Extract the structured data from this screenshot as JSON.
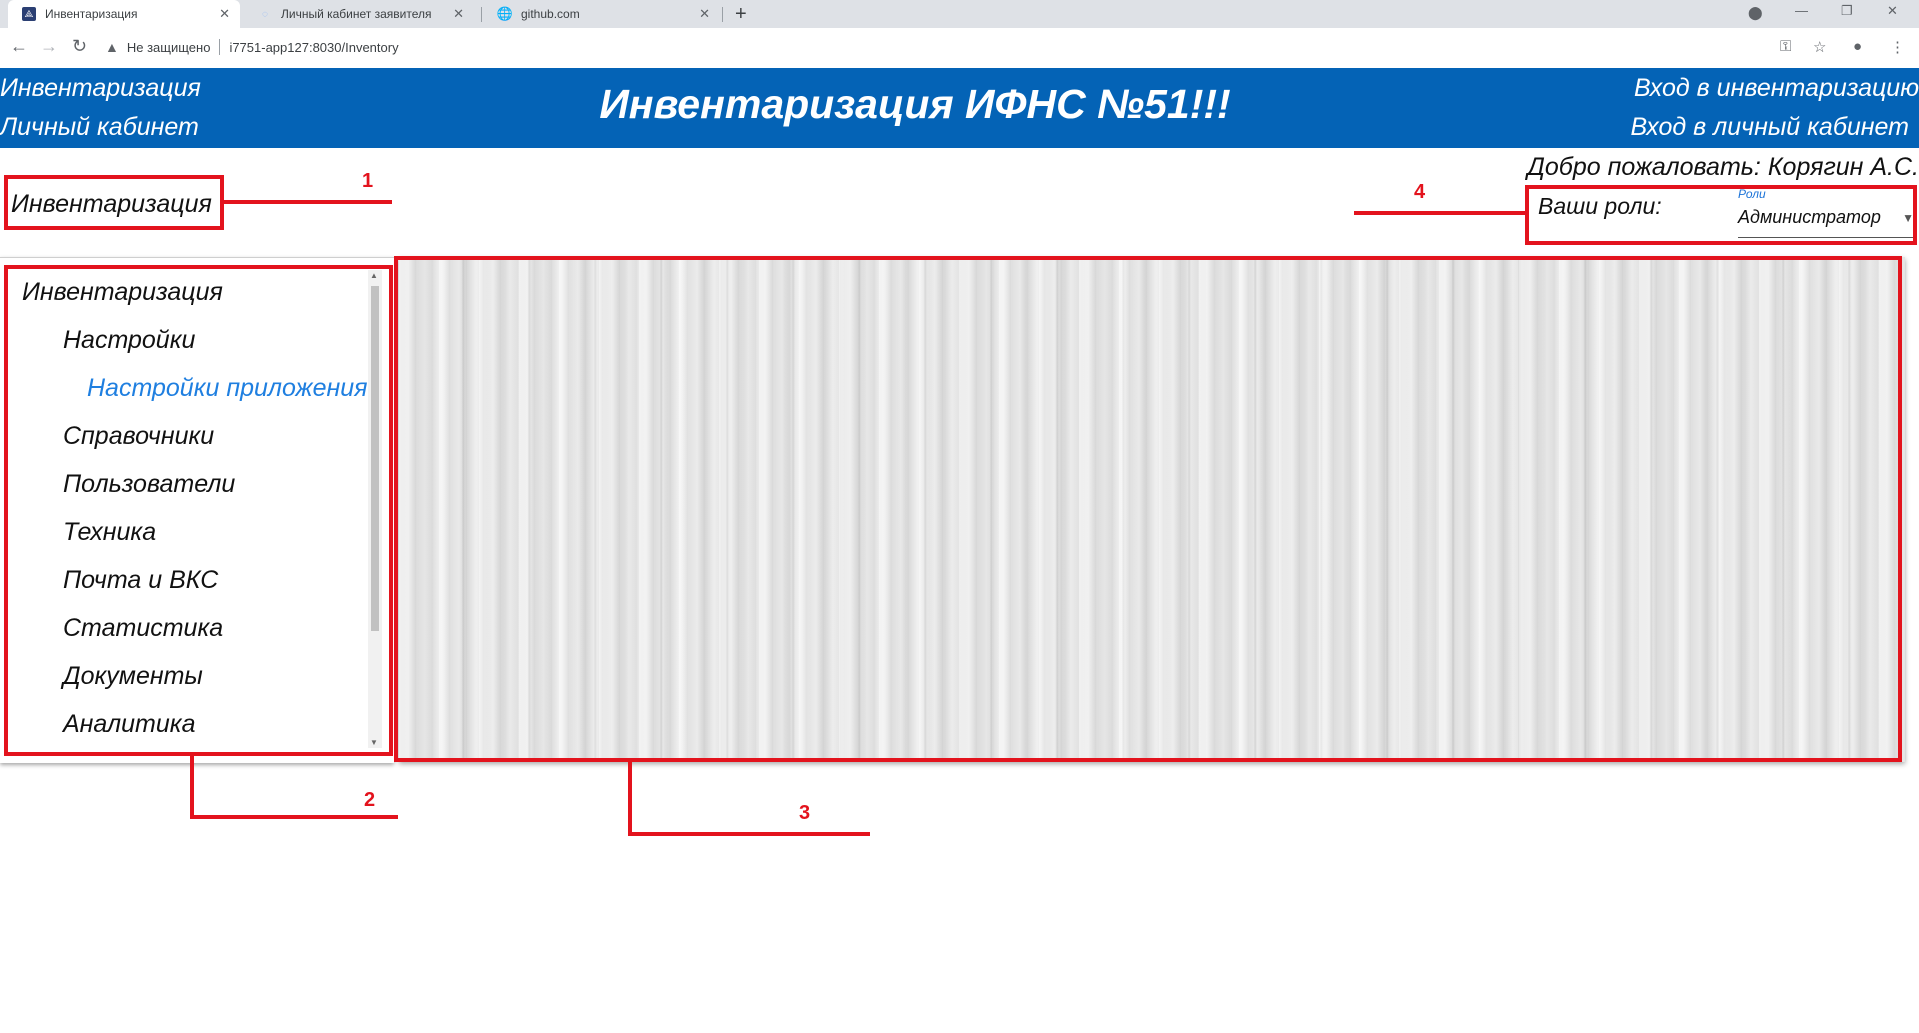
{
  "browser": {
    "tabs": [
      {
        "title": "Инвентаризация",
        "active": true,
        "icon": "app-icon"
      },
      {
        "title": "Личный кабинет заявителя",
        "active": false,
        "icon": "loading-icon"
      },
      {
        "title": "github.com",
        "active": false,
        "icon": "globe-icon"
      }
    ],
    "security_label": "Не защищено",
    "url": "i7751-app127:8030/Inventory"
  },
  "header": {
    "left_links": [
      "Инвентаризация",
      "Личный кабинет"
    ],
    "title": "Инвентаризация ИФНС №51!!!",
    "right_links": [
      "Вход в инвентаризацию",
      "Вход в личный кабинет"
    ],
    "background": "#0463b6"
  },
  "welcome_text": "Добро пожаловать: Корягин А.С.",
  "page_heading": "Инвентаризация",
  "roles": {
    "label": "Ваши роли:",
    "select_label": "Роли",
    "selected": "Администратор"
  },
  "nav": {
    "items": [
      {
        "label": "Инвентаризация",
        "level": 0
      },
      {
        "label": "Настройки",
        "level": 1
      },
      {
        "label": "Настройки приложения",
        "level": 2
      },
      {
        "label": "Справочники",
        "level": 1
      },
      {
        "label": "Пользователи",
        "level": 1
      },
      {
        "label": "Техника",
        "level": 1
      },
      {
        "label": "Почта и ВКС",
        "level": 1
      },
      {
        "label": "Статистика",
        "level": 1
      },
      {
        "label": "Документы",
        "level": 1
      },
      {
        "label": "Аналитика",
        "level": 1
      }
    ]
  },
  "annotations": {
    "labels": [
      "1",
      "2",
      "3",
      "4"
    ],
    "color": "#e3131d"
  }
}
